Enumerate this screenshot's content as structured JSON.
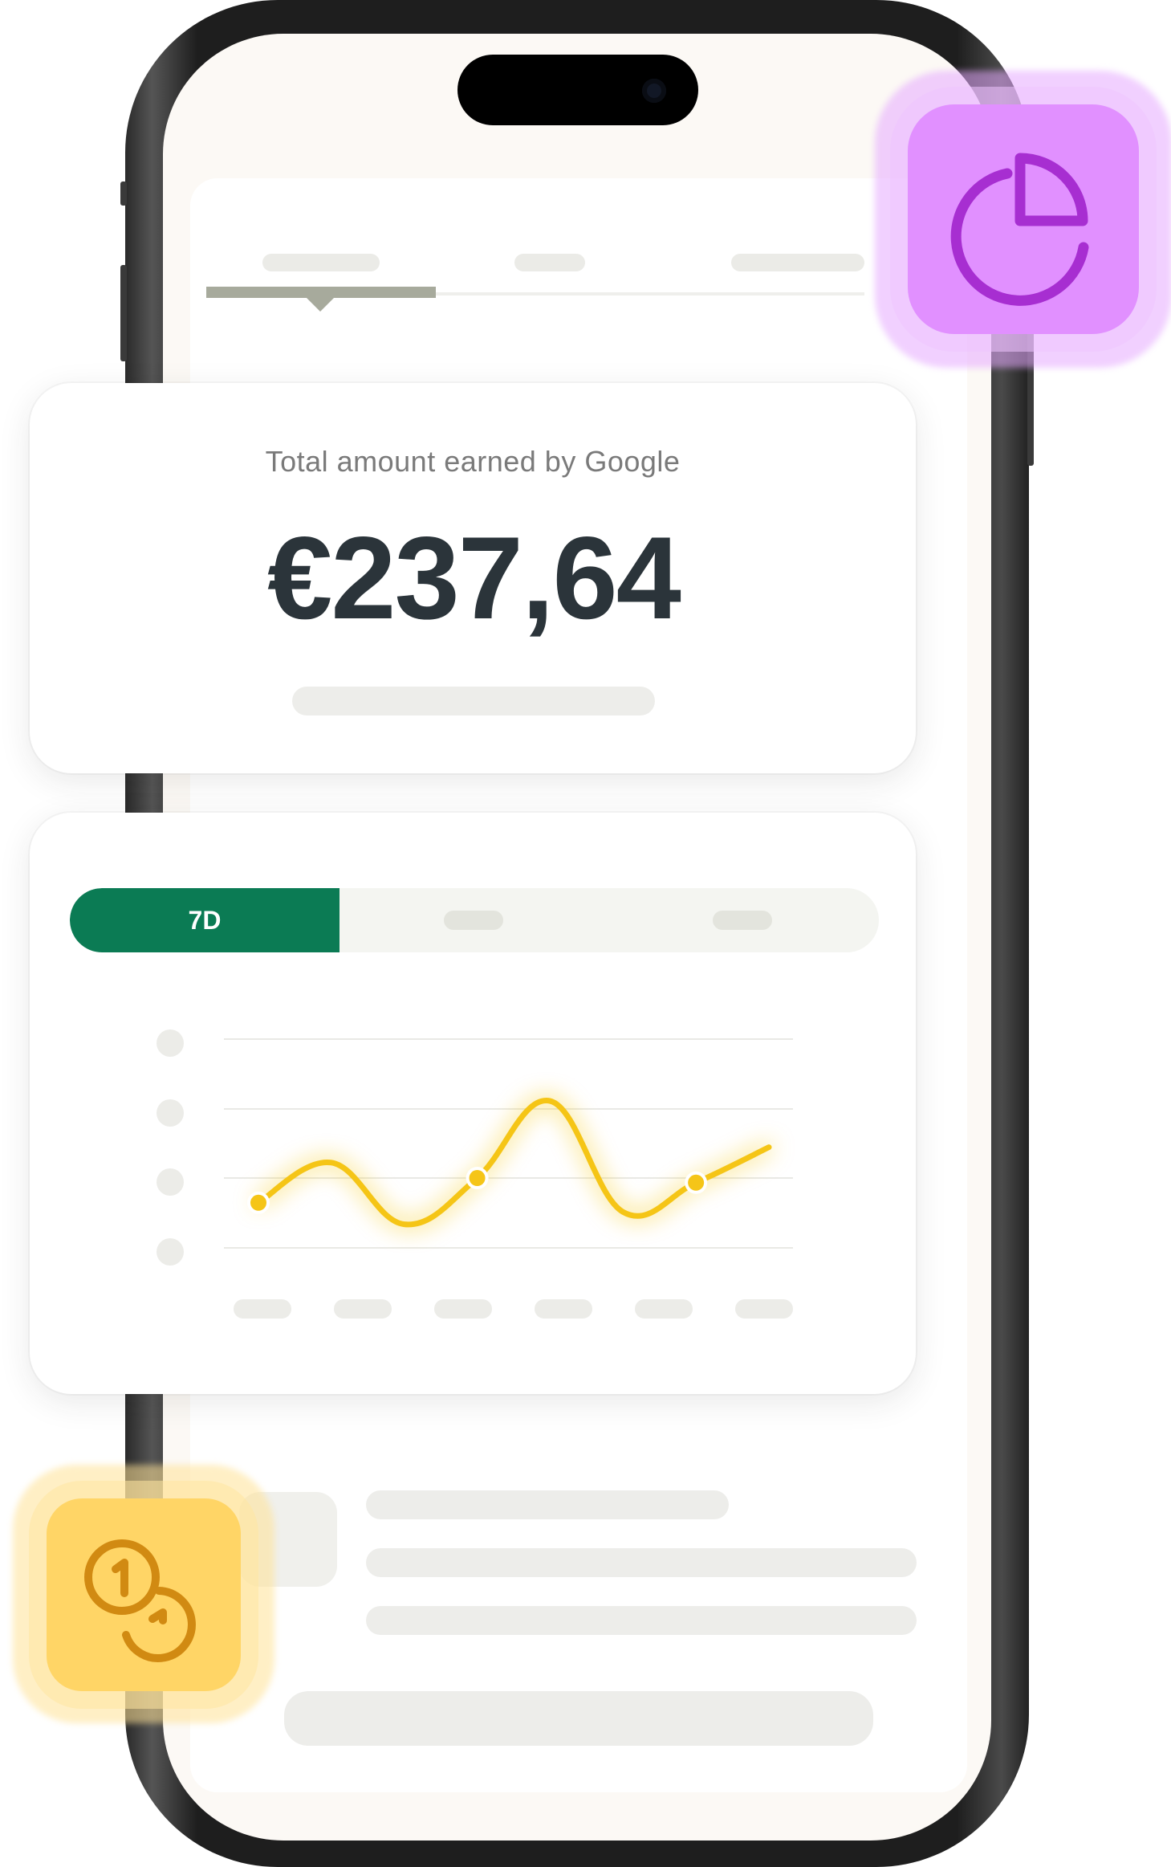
{
  "earnings_card": {
    "label": "Total amount earned by Google",
    "amount": "€237,64"
  },
  "chart_card": {
    "range_tabs": [
      {
        "label": "7D",
        "active": true
      },
      {
        "label": "",
        "active": false
      },
      {
        "label": "",
        "active": false
      }
    ]
  },
  "chart_data": {
    "type": "line",
    "series": [
      {
        "values": [
          0.22,
          0.48,
          0.08,
          0.38,
          0.88,
          0.16,
          0.35,
          0.58
        ]
      }
    ],
    "highlighted_points": [
      0,
      3,
      6
    ],
    "grid": true,
    "line_color": "#f5c518"
  },
  "colors": {
    "accent_green": "#0b7b54",
    "badge_purple": "#e190ff",
    "badge_yellow": "#ffd566",
    "amount_text": "#2b343a"
  },
  "icons": {
    "top_badge": "pie-chart-icon",
    "bottom_badge": "coins-icon"
  }
}
